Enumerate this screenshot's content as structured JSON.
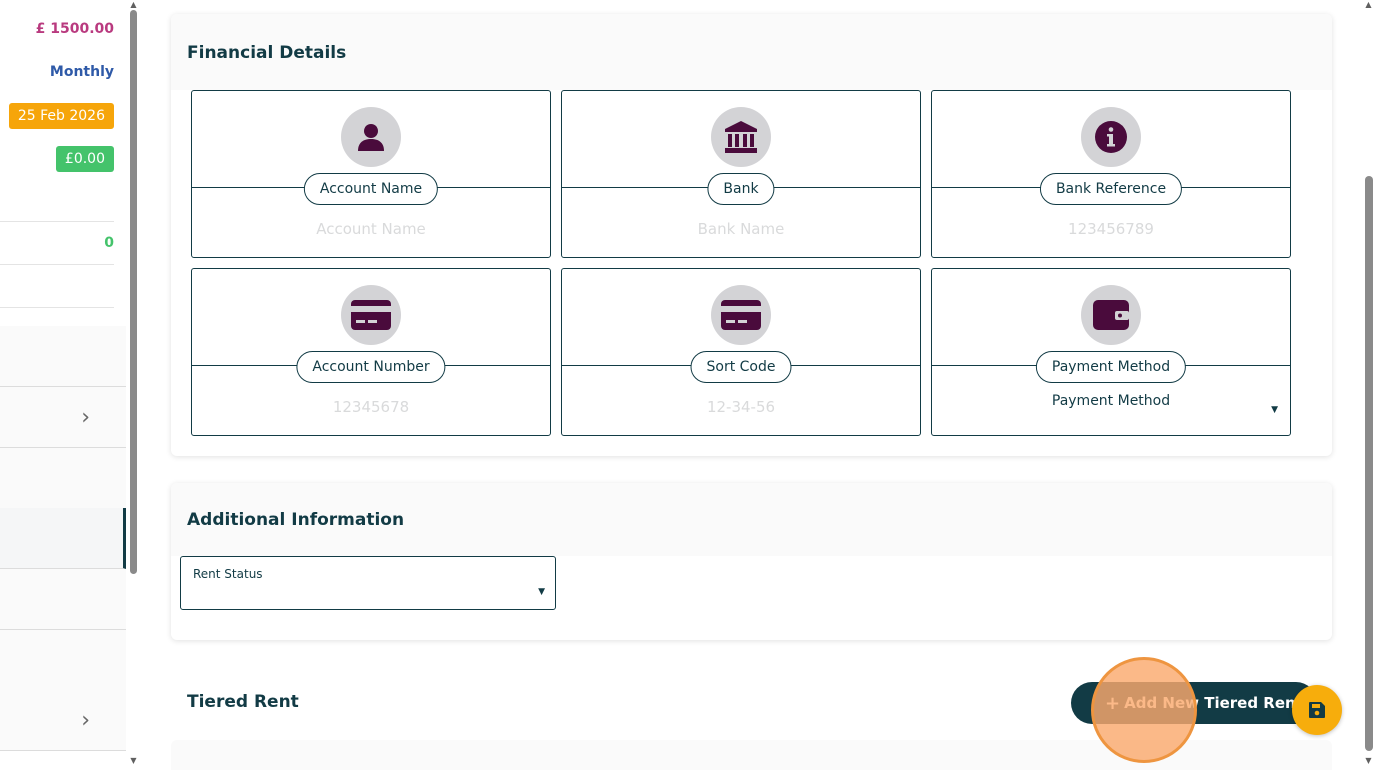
{
  "left_panel": {
    "amount": "£ 1500.00",
    "frequency": "Monthly",
    "due_date": "25 Feb 2026",
    "balance": "£0.00",
    "count": "0",
    "chevron_glyph": "›"
  },
  "financial": {
    "title": "Financial Details",
    "fields": {
      "account_name": {
        "label": "Account Name",
        "placeholder": "Account Name",
        "icon": "user-icon"
      },
      "bank": {
        "label": "Bank",
        "placeholder": "Bank Name",
        "icon": "bank-icon"
      },
      "bank_reference": {
        "label": "Bank Reference",
        "placeholder": "123456789",
        "icon": "info-icon"
      },
      "account_number": {
        "label": "Account Number",
        "placeholder": "12345678",
        "icon": "credit-card-icon"
      },
      "sort_code": {
        "label": "Sort Code",
        "placeholder": "12-34-56",
        "icon": "credit-card-icon"
      },
      "payment_method": {
        "label": "Payment Method",
        "value": "Payment Method",
        "icon": "wallet-icon"
      }
    }
  },
  "additional": {
    "title": "Additional Information",
    "rent_status_label": "Rent Status"
  },
  "tiered": {
    "title": "Tiered Rent",
    "add_button_label": "Add New Tiered Rent",
    "add_button_plus": "+"
  },
  "glyphs": {
    "caret": "▼",
    "scroll_up": "▲",
    "scroll_down": "▼"
  },
  "colors": {
    "primary": "#123b45",
    "icon_purple": "#4a0b3c",
    "save_button": "#f7ad0c",
    "badge_orange": "#f6a50a",
    "badge_green": "#44c36b",
    "amount_pink": "#b93a7f",
    "frequency_blue": "#2f5aa8"
  }
}
